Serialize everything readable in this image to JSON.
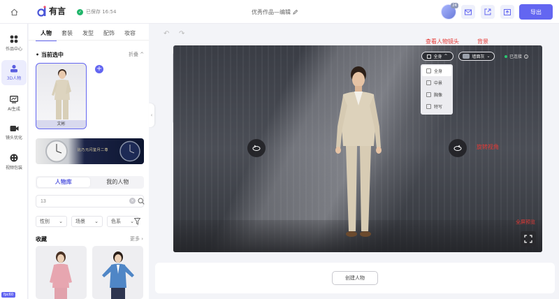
{
  "header": {
    "logo_text": "有言",
    "save_status": "已保存 16:54",
    "doc_title": "优秀作品—编辑",
    "avatar_badge": "24",
    "export_label": "导出"
  },
  "leftnav": {
    "items": [
      {
        "label": "作品中心",
        "icon": "grid-icon"
      },
      {
        "label": "3D人物",
        "icon": "person-icon"
      },
      {
        "label": "AI生成",
        "icon": "chart-icon"
      },
      {
        "label": "镜头优化",
        "icon": "camera-icon"
      },
      {
        "label": "视频包装",
        "icon": "palette-icon"
      }
    ],
    "tag": "fpc60"
  },
  "panel": {
    "tabs": [
      "人物",
      "套装",
      "发型",
      "配饰",
      "妆容"
    ],
    "current_section": "当前选中",
    "collapse_label": "折叠",
    "selected_name": "文彬",
    "banner_text": "比乃元闪鉴月二尊",
    "subtabs": [
      "人物库",
      "我的人物"
    ],
    "search_value": "13",
    "filters": [
      "性别",
      "场景",
      "色系"
    ],
    "favorites_label": "收藏",
    "more_label": "更多"
  },
  "stage": {
    "annotations": {
      "view_camera": "查看人物镜头",
      "background": "背景",
      "rotate": "旋转视角",
      "fullscreen": "全屏预览"
    },
    "view_selected": "全身",
    "bg_selected": "墙面灰",
    "connection": "已连接",
    "view_options": [
      "全身",
      "中景",
      "胸像",
      "特写"
    ]
  },
  "actions": {
    "create_label": "创建人物"
  },
  "colors": {
    "accent": "#6366f1",
    "annotation": "#e53935",
    "connected": "#29c770"
  }
}
